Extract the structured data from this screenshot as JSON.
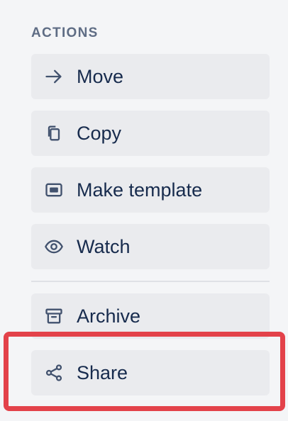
{
  "section": {
    "title": "ACTIONS"
  },
  "actions": [
    {
      "label": "Move",
      "icon": "arrow-right-icon"
    },
    {
      "label": "Copy",
      "icon": "copy-icon"
    },
    {
      "label": "Make template",
      "icon": "template-icon"
    },
    {
      "label": "Watch",
      "icon": "eye-icon"
    },
    {
      "label": "Archive",
      "icon": "archive-icon"
    },
    {
      "label": "Share",
      "icon": "share-icon"
    }
  ],
  "colors": {
    "background": "#f4f5f7",
    "button_bg": "#eaebee",
    "text": "#172b4d",
    "section_title": "#5e6c84",
    "highlight": "#e3424a"
  }
}
